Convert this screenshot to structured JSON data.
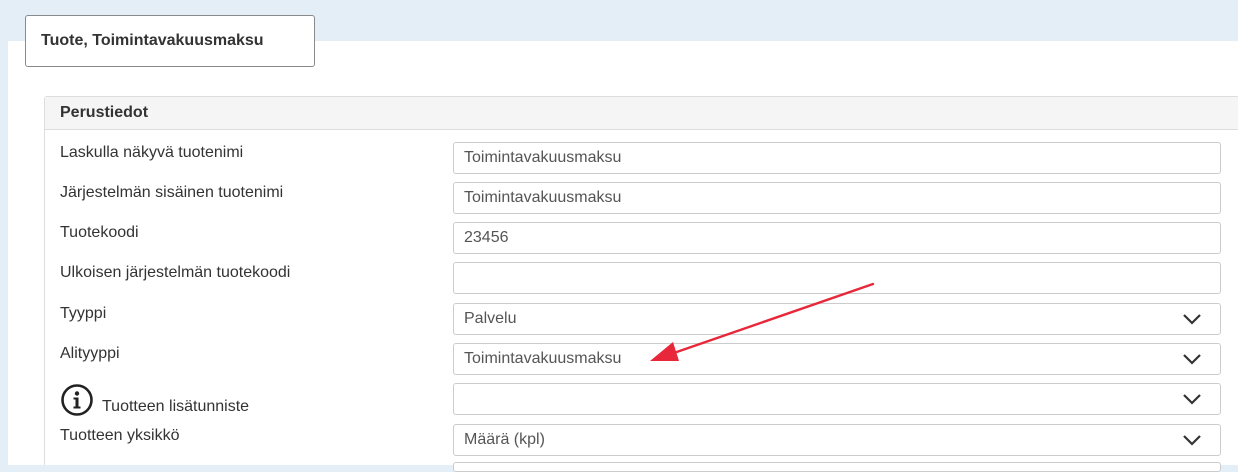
{
  "tab": {
    "label": "Tuote, Toimintavakuusmaksu"
  },
  "panel": {
    "title": "Perustiedot"
  },
  "fields": [
    {
      "label": "Laskulla näkyvä tuotenimi",
      "value": "Toimintavakuusmaksu",
      "kind": "text"
    },
    {
      "label": "Järjestelmän sisäinen tuotenimi",
      "value": "Toimintavakuusmaksu",
      "kind": "text"
    },
    {
      "label": "Tuotekoodi",
      "value": "23456",
      "kind": "text"
    },
    {
      "label": "Ulkoisen järjestelmän tuotekoodi",
      "value": "",
      "kind": "text"
    },
    {
      "label": "Tyyppi",
      "value": "Palvelu",
      "kind": "select"
    },
    {
      "label": "Alityyppi",
      "value": "Toimintavakuusmaksu",
      "kind": "select"
    },
    {
      "label": "Tuotteen lisätunniste",
      "value": "",
      "kind": "select"
    },
    {
      "label": "Tuotteen yksikkö",
      "value": "Määrä (kpl)",
      "kind": "select"
    }
  ],
  "icons": {
    "info": "info-circle-icon",
    "chevron": "chevron-down-icon"
  },
  "colors": {
    "annotation_arrow": "#e8283a",
    "header_bg": "#f5f5f5",
    "page_bg": "#e3eef7"
  }
}
